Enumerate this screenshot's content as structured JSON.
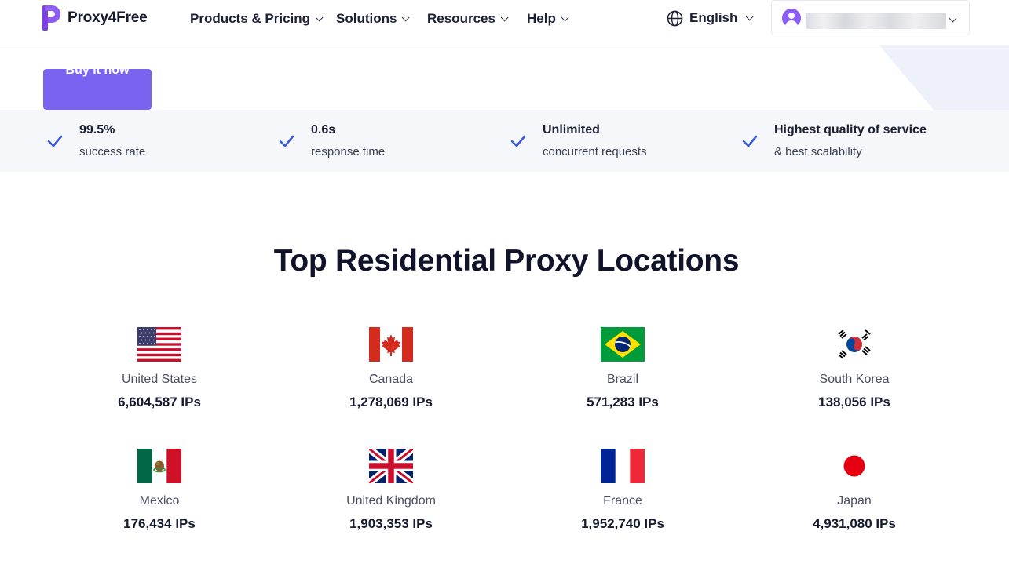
{
  "header": {
    "logo_text": "Proxy4Free",
    "nav": [
      {
        "label": "Products & Pricing"
      },
      {
        "label": "Solutions"
      },
      {
        "label": "Resources"
      },
      {
        "label": "Help"
      }
    ],
    "language": "English"
  },
  "hero": {
    "buy_button_label": "Buy it now"
  },
  "stats": [
    {
      "value": "99.5%",
      "label": "success rate"
    },
    {
      "value": "0.6s",
      "label": "response time"
    },
    {
      "value": "Unlimited",
      "label": "concurrent requests"
    },
    {
      "value": "Highest quality of service",
      "label": "& best scalability"
    }
  ],
  "locations": {
    "title": "Top Residential Proxy Locations",
    "items": [
      {
        "country": "United States",
        "ips": "6,604,587 IPs",
        "flag": "us-flag-icon"
      },
      {
        "country": "Canada",
        "ips": "1,278,069 IPs",
        "flag": "canada-flag-icon"
      },
      {
        "country": "Brazil",
        "ips": "571,283 IPs",
        "flag": "brazil-flag-icon"
      },
      {
        "country": "South Korea",
        "ips": "138,056 IPs",
        "flag": "south-korea-flag-icon"
      },
      {
        "country": "Mexico",
        "ips": "176,434 IPs",
        "flag": "mexico-flag-icon"
      },
      {
        "country": "United Kingdom",
        "ips": "1,903,353 IPs",
        "flag": "uk-flag-icon"
      },
      {
        "country": "France",
        "ips": "1,952,740 IPs",
        "flag": "france-flag-icon"
      },
      {
        "country": "Japan",
        "ips": "4,931,080 IPs",
        "flag": "japan-flag-icon"
      }
    ]
  },
  "colors": {
    "brand": "#7b63f2",
    "check": "#3b5bdb",
    "stats_bg": "#f5f7fb",
    "heading": "#10132a"
  }
}
